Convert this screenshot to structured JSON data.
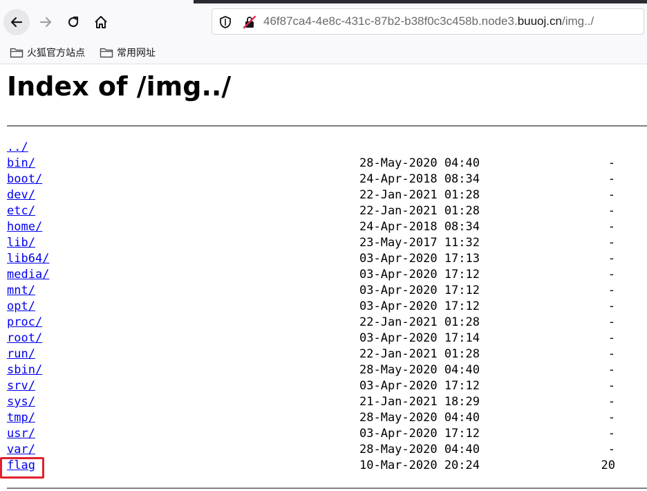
{
  "browser": {
    "url_prefix": "46f87ca4-4e8c-431c-87b2-b38f0c3c458b.node3.",
    "url_domain": "buuoj.cn",
    "url_suffix": "/img../",
    "bookmarks": [
      {
        "label": "火狐官方站点",
        "icon": "folder-icon"
      },
      {
        "label": "常用网址",
        "icon": "folder-icon"
      }
    ],
    "icons": [
      "back-icon",
      "forward-icon",
      "reload-icon",
      "home-icon",
      "shield-icon",
      "insecure-lock-icon"
    ]
  },
  "page": {
    "title": "Index of /img../",
    "entries": [
      {
        "name": "../",
        "date": "",
        "size": ""
      },
      {
        "name": "bin/",
        "date": "28-May-2020 04:40",
        "size": "-"
      },
      {
        "name": "boot/",
        "date": "24-Apr-2018 08:34",
        "size": "-"
      },
      {
        "name": "dev/",
        "date": "22-Jan-2021 01:28",
        "size": "-"
      },
      {
        "name": "etc/",
        "date": "22-Jan-2021 01:28",
        "size": "-"
      },
      {
        "name": "home/",
        "date": "24-Apr-2018 08:34",
        "size": "-"
      },
      {
        "name": "lib/",
        "date": "23-May-2017 11:32",
        "size": "-"
      },
      {
        "name": "lib64/",
        "date": "03-Apr-2020 17:13",
        "size": "-"
      },
      {
        "name": "media/",
        "date": "03-Apr-2020 17:12",
        "size": "-"
      },
      {
        "name": "mnt/",
        "date": "03-Apr-2020 17:12",
        "size": "-"
      },
      {
        "name": "opt/",
        "date": "03-Apr-2020 17:12",
        "size": "-"
      },
      {
        "name": "proc/",
        "date": "22-Jan-2021 01:28",
        "size": "-"
      },
      {
        "name": "root/",
        "date": "03-Apr-2020 17:14",
        "size": "-"
      },
      {
        "name": "run/",
        "date": "22-Jan-2021 01:28",
        "size": "-"
      },
      {
        "name": "sbin/",
        "date": "28-May-2020 04:40",
        "size": "-"
      },
      {
        "name": "srv/",
        "date": "03-Apr-2020 17:12",
        "size": "-"
      },
      {
        "name": "sys/",
        "date": "21-Jan-2021 18:29",
        "size": "-"
      },
      {
        "name": "tmp/",
        "date": "28-May-2020 04:40",
        "size": "-"
      },
      {
        "name": "usr/",
        "date": "03-Apr-2020 17:12",
        "size": "-"
      },
      {
        "name": "var/",
        "date": "28-May-2020 04:40",
        "size": "-"
      },
      {
        "name": "flag",
        "date": "10-Mar-2020 20:24",
        "size": "20"
      }
    ],
    "highlight_color": "#e0212c",
    "link_color": "#0000ee"
  }
}
